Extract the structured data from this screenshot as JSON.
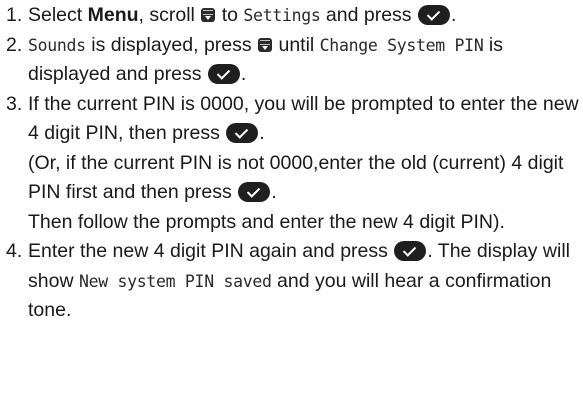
{
  "steps": [
    {
      "number": "1.",
      "parts": {
        "select": "Select ",
        "menu": "Menu",
        "scroll": ", scroll ",
        "to": " to ",
        "settings": "Settings",
        "press": " and press ",
        "end": "."
      }
    },
    {
      "number": "2.",
      "parts": {
        "sounds": "Sounds",
        "displayed": " is displayed, press ",
        "until": " until ",
        "change_pin": "Change System PIN",
        "displayed2": " is displayed and press ",
        "end": "."
      }
    },
    {
      "number": "3.",
      "parts": {
        "line1": "If the current PIN is 0000, you will be prompted to enter the new 4 digit PIN, then press ",
        "line1_end": ".",
        "line2": "(Or, if the current PIN is not 0000,enter the old (current) 4 digit PIN first and then press ",
        "line2_end": ".",
        "line3": "Then follow the prompts and enter the new 4 digit PIN)."
      }
    },
    {
      "number": "4.",
      "parts": {
        "enter": "Enter the new 4 digit PIN again and press ",
        "the_display": ". The display will show ",
        "saved": "New system PIN saved",
        "tone": " and you will hear a confirmation tone."
      }
    }
  ],
  "icons": {
    "scroll_key": "scroll-down-key-icon",
    "ok_key": "ok-checkmark-key-icon"
  }
}
